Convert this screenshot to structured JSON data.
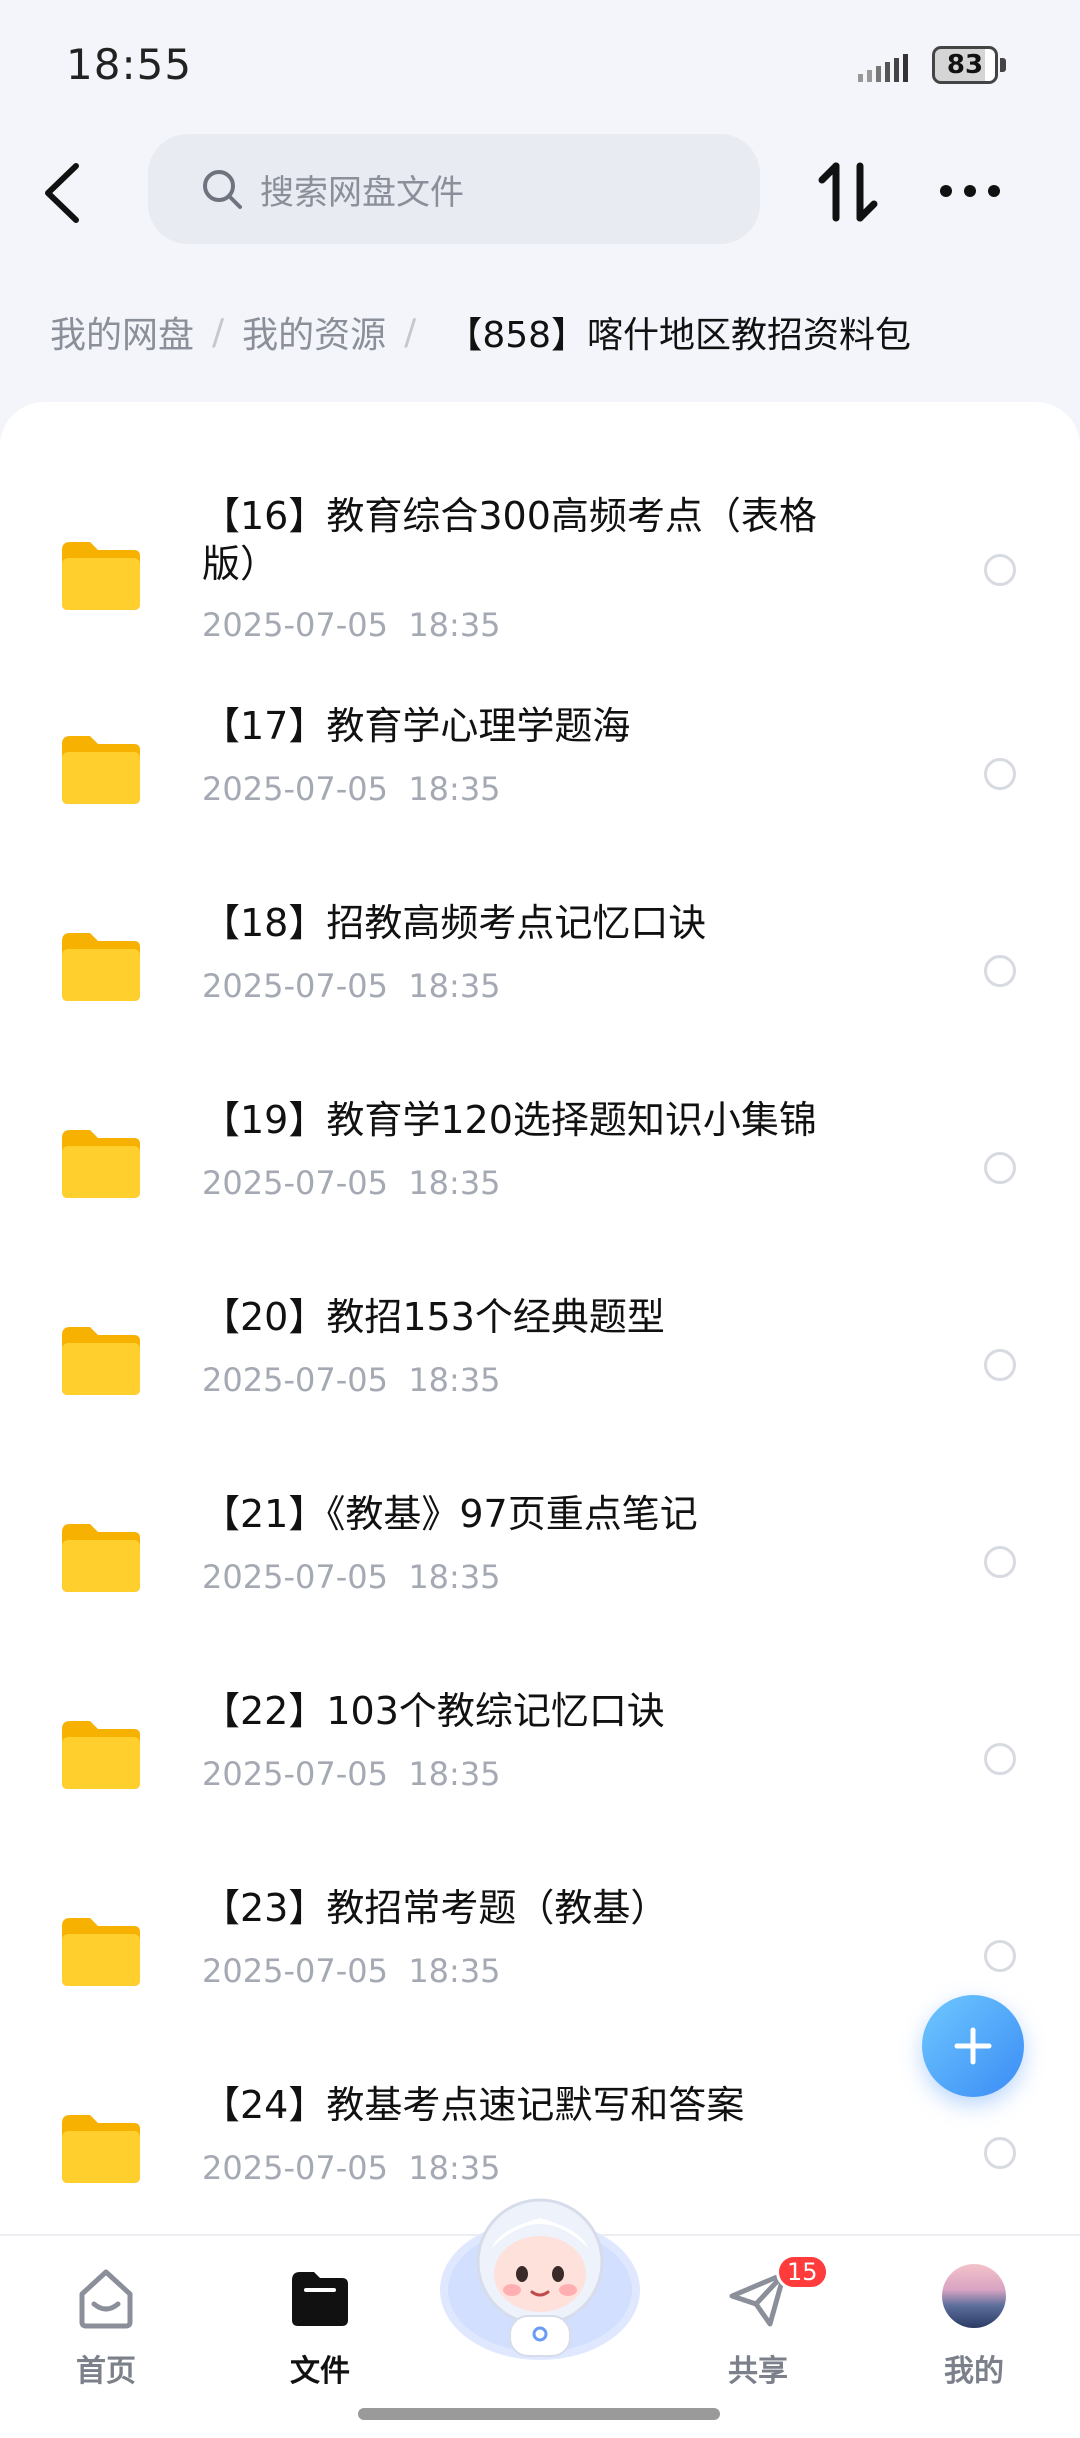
{
  "status_bar": {
    "time": "18:55",
    "battery": "83",
    "battery_level": 0.83
  },
  "search": {
    "placeholder": "搜索网盘文件"
  },
  "breadcrumb": {
    "items": [
      "我的网盘",
      "我的资源"
    ],
    "separator": "/",
    "current": "【858】喀什地区教招资料包"
  },
  "files": [
    {
      "title": "【16】教育综合300高频考点（表格版）",
      "date": "2025-07-05  18:35"
    },
    {
      "title": "【17】教育学心理学题海",
      "date": "2025-07-05  18:35"
    },
    {
      "title": "【18】招教高频考点记忆口诀",
      "date": "2025-07-05  18:35"
    },
    {
      "title": "【19】教育学120选择题知识小集锦",
      "date": "2025-07-05  18:35"
    },
    {
      "title": "【20】教招153个经典题型",
      "date": "2025-07-05  18:35"
    },
    {
      "title": "【21】《教基》97页重点笔记",
      "date": "2025-07-05  18:35"
    },
    {
      "title": "【22】103个教综记忆口诀",
      "date": "2025-07-05  18:35"
    },
    {
      "title": "【23】教招常考题（教基）",
      "date": "2025-07-05  18:35"
    },
    {
      "title": "【24】教基考点速记默写和答案",
      "date": "2025-07-05  18:35"
    }
  ],
  "tabbar": {
    "home": "首页",
    "files": "文件",
    "share": "共享",
    "share_badge": "15",
    "mine": "我的"
  },
  "colors": {
    "accent": "#3a8cf5",
    "folder": "#ffc928",
    "badge": "#ff3b3b"
  }
}
